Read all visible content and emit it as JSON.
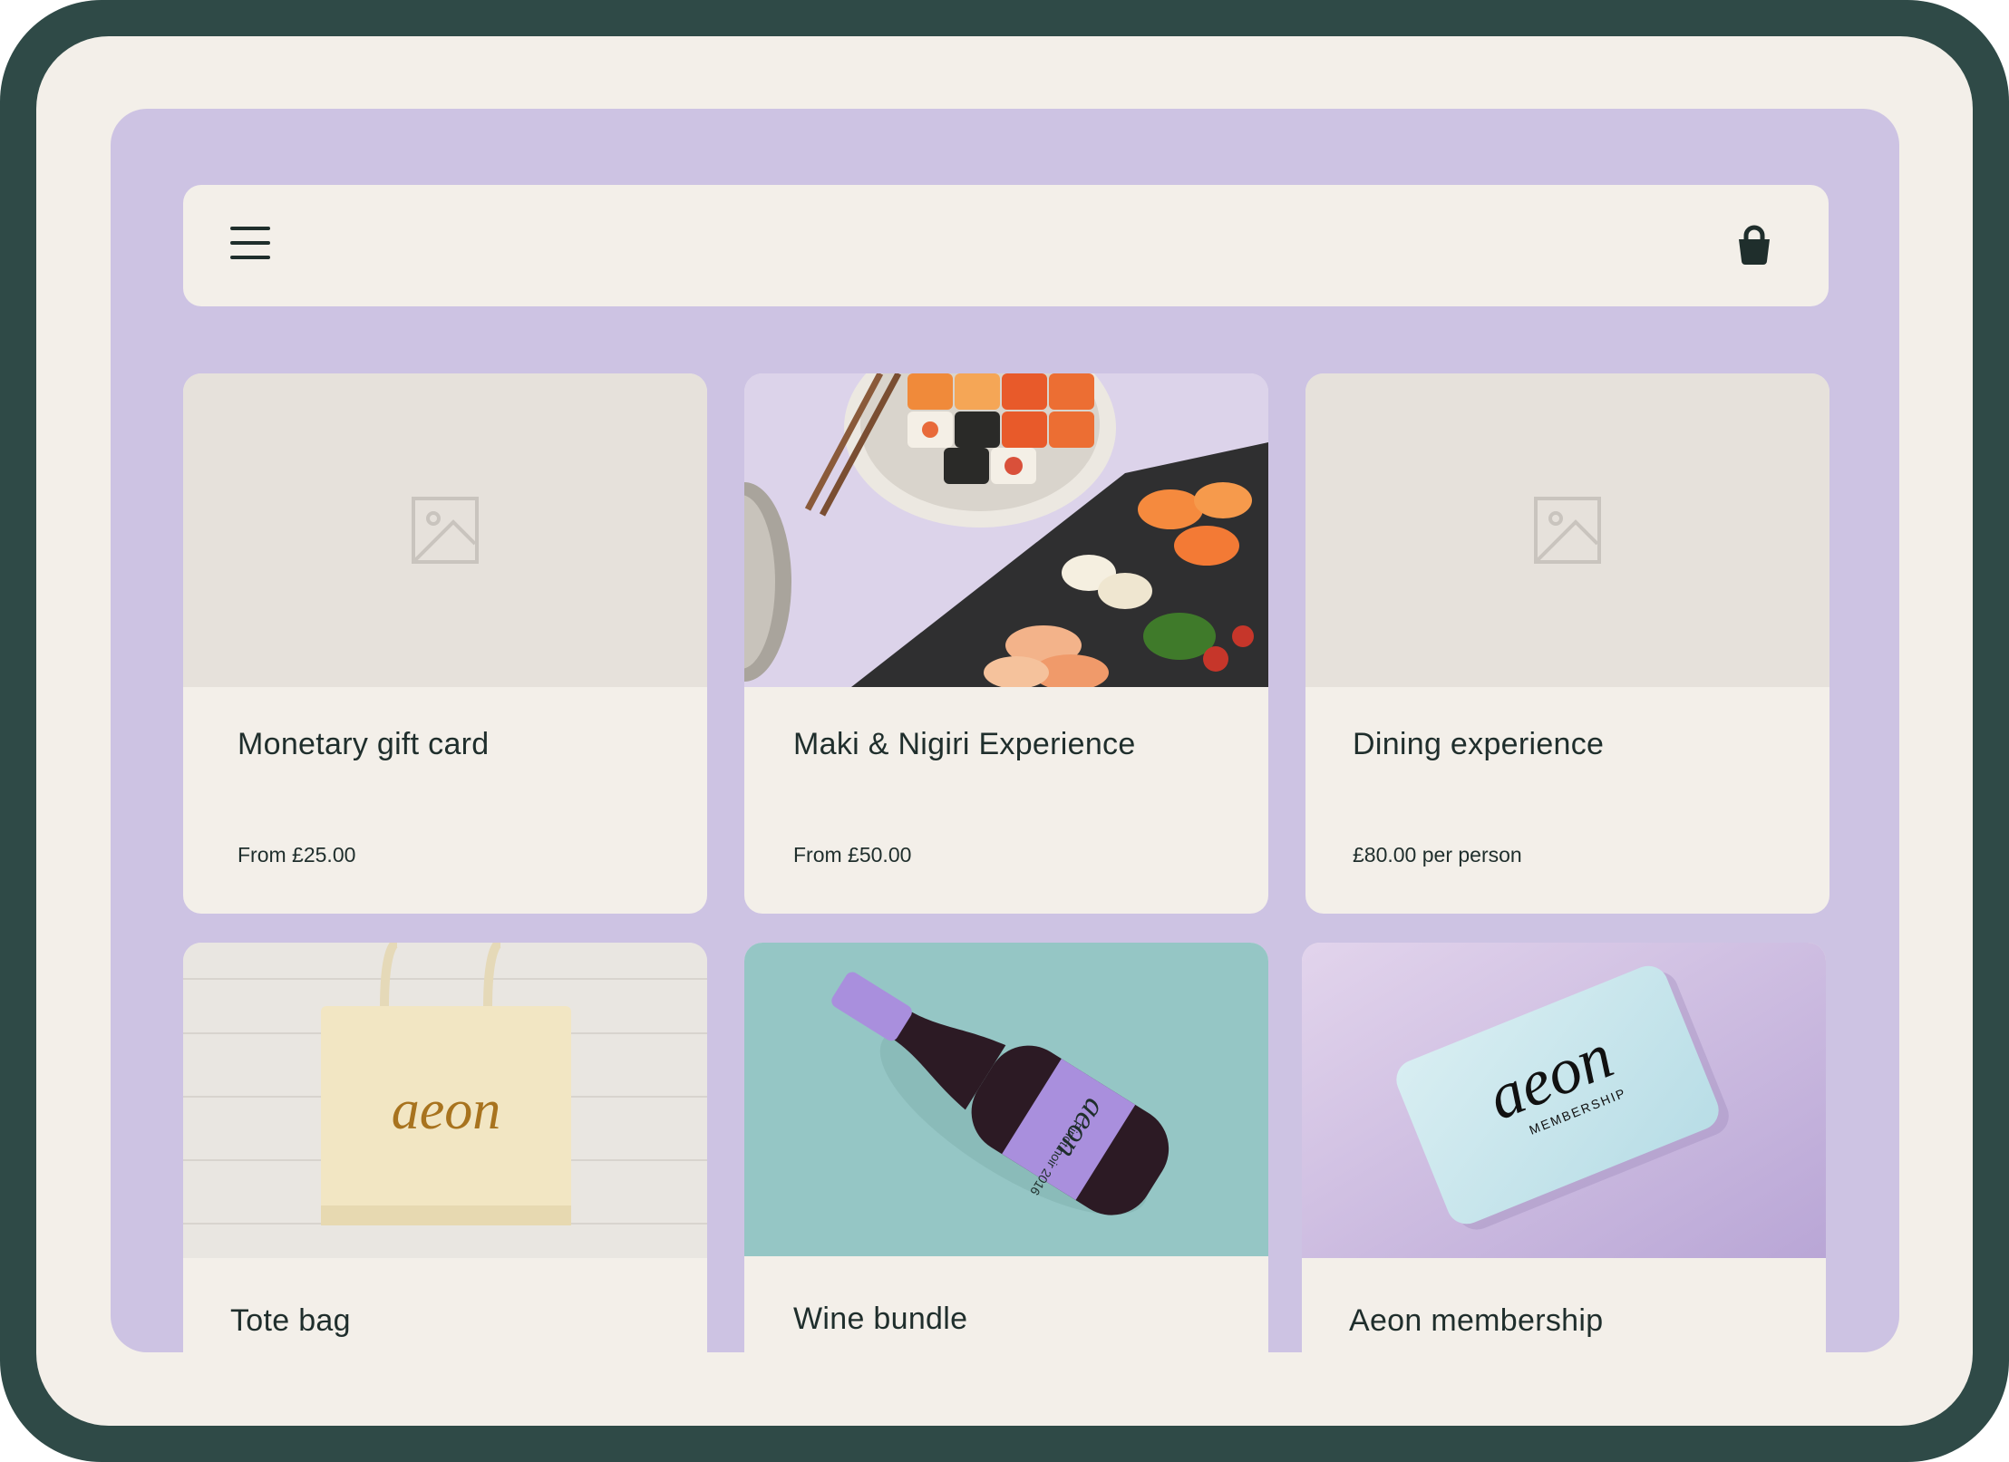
{
  "header": {
    "menu_icon": "hamburger-menu-icon",
    "cart_icon": "shopping-basket-icon"
  },
  "products": [
    {
      "title": "Monetary gift card",
      "price": "From £25.00",
      "image": "image-placeholder-icon"
    },
    {
      "title": "Maki & Nigiri Experience",
      "price": "From £50.00",
      "image": "sushi-photo"
    },
    {
      "title": "Dining experience",
      "price": "£80.00 per person",
      "image": "image-placeholder-icon"
    },
    {
      "title": "Tote bag",
      "image": "tote-bag-photo",
      "logo_text": "aeon"
    },
    {
      "title": "Wine bundle",
      "image": "wine-bottle-photo",
      "label_text": "Pinot noir 2016"
    },
    {
      "title": "Aeon membership",
      "image": "membership-card-photo",
      "card_text": "MEMBERSHIP"
    }
  ],
  "colors": {
    "frame": "#2f4a47",
    "screen": "#f3efe9",
    "panel": "#cdc3e3",
    "text": "#1f2e2c"
  }
}
